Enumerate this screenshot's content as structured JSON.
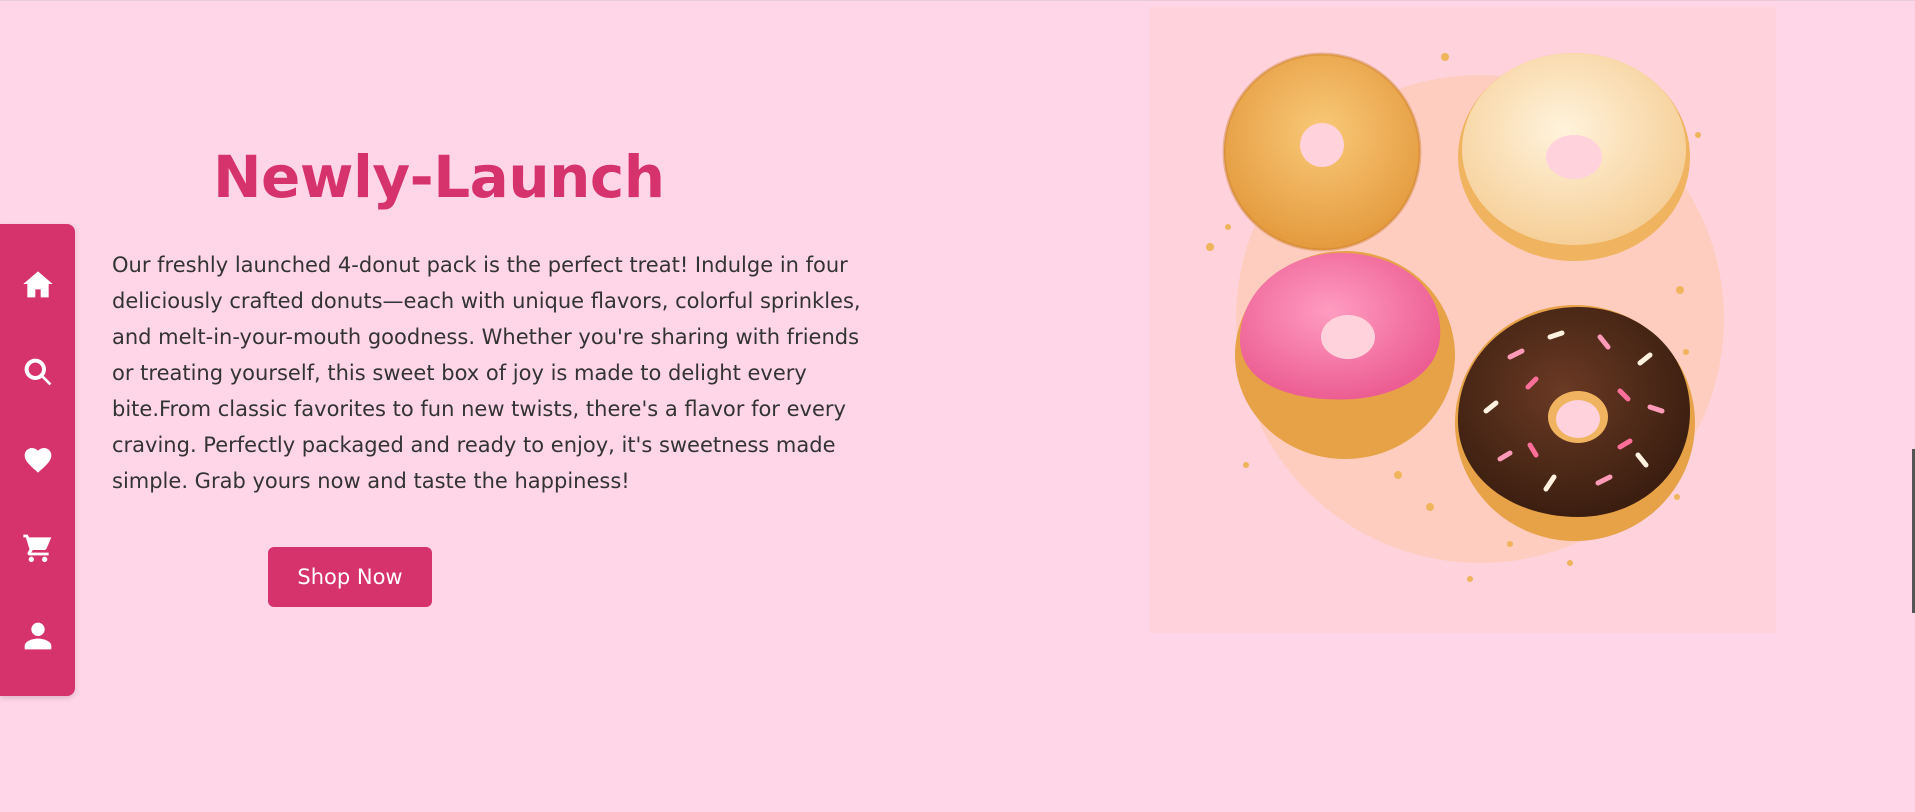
{
  "sidebar": {
    "items": [
      {
        "icon": "home-icon",
        "label": "Home"
      },
      {
        "icon": "search-icon",
        "label": "Search"
      },
      {
        "icon": "heart-icon",
        "label": "Favorites"
      },
      {
        "icon": "cart-icon",
        "label": "Cart"
      },
      {
        "icon": "user-icon",
        "label": "Account"
      }
    ]
  },
  "hero": {
    "title": "Newly-Launch",
    "description": "Our freshly launched 4-donut pack is the perfect treat! Indulge in four deliciously crafted donuts—each with unique flavors, colorful sprinkles, and melt-in-your-mouth goodness. Whether you're sharing with friends or treating yourself, this sweet box of joy is made to delight every bite.From classic favorites to fun new twists, there's a flavor for every craving. Perfectly packaged and ready to enjoy, it's sweetness made simple. Grab yours now and taste the happiness!",
    "cta_label": "Shop Now",
    "image_alt": "Four donuts: sugar, glazed, pink frosted and chocolate sprinkled"
  },
  "colors": {
    "background": "#ffd6e7",
    "accent": "#d6336c",
    "text": "#333333"
  }
}
